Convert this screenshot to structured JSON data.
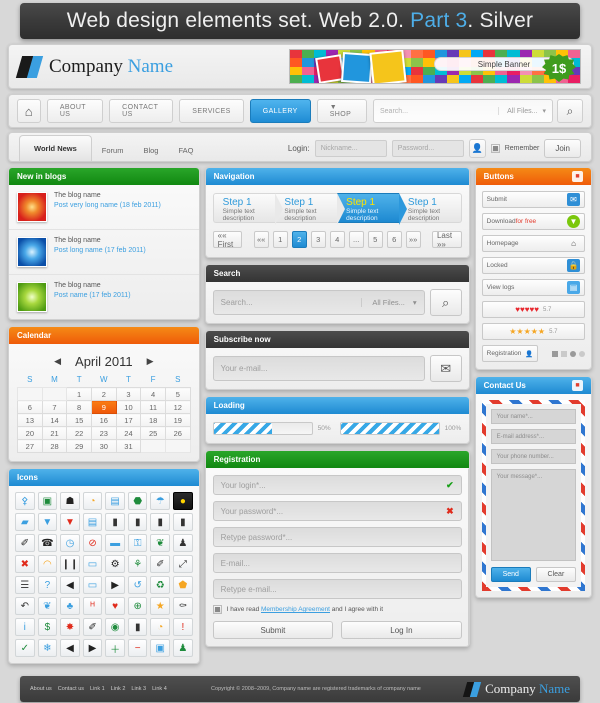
{
  "title": {
    "part1": "Web design elements set. Web 2.0. ",
    "accent": "Part 3",
    "part2": ". Silver"
  },
  "header": {
    "company_primary": "Company",
    "company_accent": "Name",
    "banner_label": "Simple Banner",
    "price_badge": "1$"
  },
  "nav": {
    "home_icon": "home-icon",
    "items": [
      {
        "label": "ABOUT US",
        "active": false
      },
      {
        "label": "CONTACT US",
        "active": false
      },
      {
        "label": "SERVICES",
        "active": false
      },
      {
        "label": "GALLERY",
        "active": true
      },
      {
        "label": "▼ SHOP",
        "active": false
      }
    ],
    "search_placeholder": "Search...",
    "search_filter": "All Files...",
    "search_icon": "search-icon"
  },
  "tabs": {
    "items": [
      {
        "label": "World News",
        "active": true
      },
      {
        "label": "Forum",
        "active": false
      },
      {
        "label": "Blog",
        "active": false
      },
      {
        "label": "FAQ",
        "active": false
      }
    ]
  },
  "login": {
    "label": "Login:",
    "nickname_placeholder": "Nickname...",
    "password_placeholder": "Password...",
    "user_icon": "user-icon",
    "remember_label": "Remember",
    "join_label": "Join"
  },
  "blogs": {
    "panel_title": "New in blogs",
    "items": [
      {
        "title": "The blog name",
        "sub": "Post very long name (18 feb 2011)",
        "thumb": "th-red"
      },
      {
        "title": "The blog name",
        "sub": "Post long name (17 feb 2011)",
        "thumb": "th-blue"
      },
      {
        "title": "The blog name",
        "sub": "Post name (17 feb 2011)",
        "thumb": "th-green"
      }
    ]
  },
  "calendar": {
    "panel_title": "Calendar",
    "month": "April 2011",
    "prev_icon": "arrow-left-icon",
    "next_icon": "arrow-right-icon",
    "daynames": [
      "S",
      "M",
      "T",
      "W",
      "T",
      "F",
      "S"
    ],
    "weeks": [
      [
        "",
        "",
        "1",
        "2",
        "3",
        "4",
        "5"
      ],
      [
        "6",
        "7",
        "8",
        "9",
        "10",
        "11",
        "12"
      ],
      [
        "13",
        "14",
        "15",
        "16",
        "17",
        "18",
        "19"
      ],
      [
        "20",
        "21",
        "22",
        "23",
        "24",
        "25",
        "26"
      ],
      [
        "27",
        "28",
        "29",
        "30",
        "31",
        "",
        ""
      ]
    ],
    "today": "9"
  },
  "navigation": {
    "panel_title": "Navigation",
    "steps": [
      {
        "title": "Step 1",
        "desc": "Simple text description",
        "active": false
      },
      {
        "title": "Step 1",
        "desc": "Simple text description",
        "active": false
      },
      {
        "title": "Step 1",
        "desc": "Simple text description",
        "active": true
      },
      {
        "title": "Step 1",
        "desc": "Simple text description",
        "active": false
      }
    ],
    "pagination": {
      "first": "«« First",
      "prev": "««",
      "pages": [
        "1",
        "2",
        "3",
        "4",
        "...",
        "5",
        "6"
      ],
      "current": "2",
      "next": "»»",
      "last": "Last »»"
    }
  },
  "search_panel": {
    "panel_title": "Search",
    "placeholder": "Search...",
    "filter": "All Files...",
    "icon": "search-icon"
  },
  "subscribe": {
    "panel_title": "Subscribe now",
    "placeholder": "Your e-mail...",
    "icon": "envelope-icon"
  },
  "loading": {
    "panel_title": "Loading",
    "bars": [
      {
        "percent": 50,
        "label": "50%"
      },
      {
        "percent": 100,
        "label": "100%"
      }
    ]
  },
  "buttons_panel": {
    "panel_title": "Buttons",
    "close_icon": "close-icon",
    "items": [
      {
        "label": "Submit",
        "icon": "mail-icon",
        "icon_color": "#2f8fd6"
      },
      {
        "label": "Download ",
        "label_accent": "for free",
        "icon": "download-icon",
        "icon_color": "#7ac70c"
      },
      {
        "label": "Homepage",
        "icon": "home-icon",
        "icon_color": "#555555"
      },
      {
        "label": "Locked",
        "icon": "lock-icon",
        "icon_color": "#2f8fd6"
      },
      {
        "label": "View logs",
        "icon": "document-icon",
        "icon_color": "#49a8e8"
      }
    ],
    "hearts": {
      "count": 5,
      "value": "5.7",
      "color": "#e8262d"
    },
    "stars": {
      "count": 5,
      "value": "5.7",
      "color": "#f5a623"
    },
    "registration_label": "Registration",
    "registration_icon": "user-add-icon"
  },
  "icons_panel": {
    "panel_title": "Icons",
    "glyphs": [
      {
        "g": "⚴",
        "c": "#3b9fe0"
      },
      {
        "g": "▣",
        "c": "#1e8b3c"
      },
      {
        "g": "☗",
        "c": "#222222"
      },
      {
        "g": "◔",
        "c": "#f5a623"
      },
      {
        "g": "▤",
        "c": "#3b9fe0"
      },
      {
        "g": "⬣",
        "c": "#1e8b3c"
      },
      {
        "g": "☂",
        "c": "#3b9fe0"
      },
      {
        "g": "●",
        "c": "#ffd400",
        "dark": true
      },
      {
        "g": "▰",
        "c": "#3b9fe0"
      },
      {
        "g": "▼",
        "c": "#3b9fe0"
      },
      {
        "g": "▼",
        "c": "#e02b1c"
      },
      {
        "g": "▤",
        "c": "#3b9fe0"
      },
      {
        "g": "▮",
        "c": "#333333"
      },
      {
        "g": "▮",
        "c": "#333333"
      },
      {
        "g": "▮",
        "c": "#333333"
      },
      {
        "g": "▮",
        "c": "#333333"
      },
      {
        "g": "✐",
        "c": "#222222"
      },
      {
        "g": "☎",
        "c": "#222222"
      },
      {
        "g": "◷",
        "c": "#3b9fe0"
      },
      {
        "g": "⊘",
        "c": "#e02b1c"
      },
      {
        "g": "▬",
        "c": "#3b9fe0"
      },
      {
        "g": "⚿",
        "c": "#3b9fe0"
      },
      {
        "g": "❦",
        "c": "#1e8b3c"
      },
      {
        "g": "♟",
        "c": "#333333"
      },
      {
        "g": "✖",
        "c": "#e02b1c"
      },
      {
        "g": "◠",
        "c": "#f5a623"
      },
      {
        "g": "❙❙",
        "c": "#333333"
      },
      {
        "g": "▭",
        "c": "#3b9fe0"
      },
      {
        "g": "⚙",
        "c": "#222222"
      },
      {
        "g": "⚘",
        "c": "#1e8b3c"
      },
      {
        "g": "✐",
        "c": "#333333"
      },
      {
        "g": "⤢",
        "c": "#333333"
      },
      {
        "g": "☰",
        "c": "#444444"
      },
      {
        "g": "?",
        "c": "#3b9fe0"
      },
      {
        "g": "◀",
        "c": "#222222"
      },
      {
        "g": "▭",
        "c": "#3b9fe0"
      },
      {
        "g": "▶",
        "c": "#222222"
      },
      {
        "g": "↺",
        "c": "#3b9fe0"
      },
      {
        "g": "♻",
        "c": "#1e8b3c"
      },
      {
        "g": "⬟",
        "c": "#f5a623"
      },
      {
        "g": "↶",
        "c": "#333333"
      },
      {
        "g": "❦",
        "c": "#3b9fe0"
      },
      {
        "g": "♣",
        "c": "#3b9fe0"
      },
      {
        "g": "ᴴ",
        "c": "#e02b1c"
      },
      {
        "g": "♥",
        "c": "#e02b1c"
      },
      {
        "g": "⊕",
        "c": "#1e8b3c"
      },
      {
        "g": "★",
        "c": "#f5a623"
      },
      {
        "g": "⚰",
        "c": "#333333"
      },
      {
        "g": "i",
        "c": "#3b9fe0"
      },
      {
        "g": "$",
        "c": "#1e8b3c"
      },
      {
        "g": "✸",
        "c": "#e02b1c"
      },
      {
        "g": "✐",
        "c": "#222222"
      },
      {
        "g": "◉",
        "c": "#1e8b3c"
      },
      {
        "g": "▮",
        "c": "#333333"
      },
      {
        "g": "◔",
        "c": "#f5a623"
      },
      {
        "g": "!",
        "c": "#e02b1c"
      },
      {
        "g": "✓",
        "c": "#1e8b3c"
      },
      {
        "g": "❄",
        "c": "#3b9fe0"
      },
      {
        "g": "◀",
        "c": "#222222"
      },
      {
        "g": "▶",
        "c": "#222222"
      },
      {
        "g": "＋",
        "c": "#1e8b3c"
      },
      {
        "g": "−",
        "c": "#e02b1c"
      },
      {
        "g": "▣",
        "c": "#3b9fe0"
      },
      {
        "g": "♟",
        "c": "#1e8b3c"
      }
    ]
  },
  "registration": {
    "panel_title": "Registration",
    "fields": [
      {
        "placeholder": "Your login*...",
        "status": "ok",
        "mark": "✔"
      },
      {
        "placeholder": "Your password*...",
        "status": "err",
        "mark": "✖"
      },
      {
        "placeholder": "Retype password*...",
        "status": "",
        "mark": ""
      },
      {
        "placeholder": "E-mail...",
        "status": "",
        "mark": ""
      },
      {
        "placeholder": "Retype e-mail...",
        "status": "",
        "mark": ""
      }
    ],
    "agree_pre": "I have read ",
    "agree_link": "Membership Agreement",
    "agree_post": " and I agree with it",
    "submit_label": "Submit",
    "login_label": "Log In"
  },
  "contact": {
    "panel_title": "Contact Us",
    "close_icon": "close-icon",
    "fields": [
      "Your name*...",
      "E-mail address*...",
      "Your phone number..."
    ],
    "message_placeholder": "Your message*...",
    "send_label": "Send",
    "clear_label": "Clear"
  },
  "footer": {
    "links": [
      "About us",
      "Contact us",
      "Link 1",
      "Link 2",
      "Link 3",
      "Link 4"
    ],
    "copyright": "Copyright © 2008–2009, Company name are registered trademarks of company name",
    "company_primary": "Company",
    "company_accent": "Name"
  }
}
